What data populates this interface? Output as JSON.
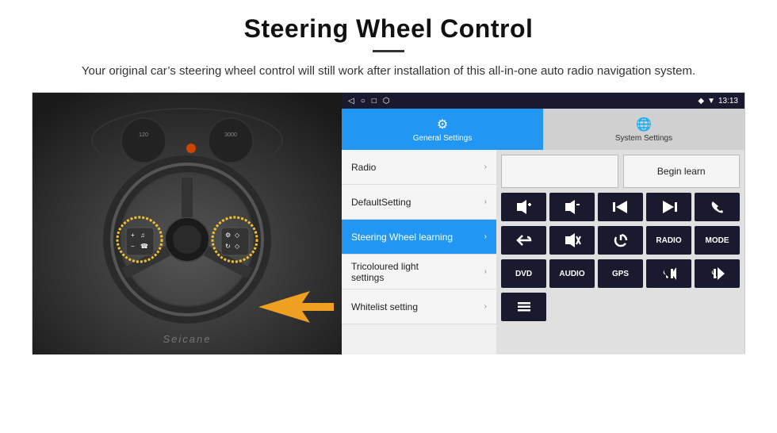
{
  "header": {
    "title": "Steering Wheel Control",
    "divider": true,
    "subtitle": "Your original car’s steering wheel control will still work after installation of this all-in-one auto radio navigation system."
  },
  "status_bar": {
    "left_icons": [
      "◁",
      "○",
      "□",
      "⬡"
    ],
    "time": "13:13",
    "signal_icons": [
      "◆",
      "▼"
    ]
  },
  "tabs": [
    {
      "label": "General Settings",
      "active": true,
      "icon": "⚙"
    },
    {
      "label": "System Settings",
      "active": false,
      "icon": "🌐"
    }
  ],
  "menu_items": [
    {
      "label": "Radio",
      "active": false
    },
    {
      "label": "DefaultSetting",
      "active": false
    },
    {
      "label": "Steering Wheel learning",
      "active": true
    },
    {
      "label": "Tricoloured light settings",
      "active": false
    },
    {
      "label": "Whitelist setting",
      "active": false
    }
  ],
  "right_panel": {
    "radio_label": "",
    "begin_learn": "Begin learn",
    "buttons_row1": [
      {
        "icon": "◀+",
        "label": "vol+"
      },
      {
        "icon": "◀−",
        "label": "vol-"
      },
      {
        "icon": "⏮",
        "label": "prev"
      },
      {
        "icon": "⏭",
        "label": "next"
      },
      {
        "icon": "✆",
        "label": "call"
      }
    ],
    "buttons_row2": [
      {
        "icon": "↩",
        "label": "back"
      },
      {
        "icon": "◀✕",
        "label": "mute"
      },
      {
        "icon": "⏻",
        "label": "power"
      },
      {
        "icon": "RADIO",
        "label": "radio"
      },
      {
        "icon": "MODE",
        "label": "mode"
      }
    ],
    "buttons_row3": [
      {
        "icon": "DVD",
        "label": "dvd"
      },
      {
        "icon": "AUDIO",
        "label": "audio"
      },
      {
        "icon": "GPS",
        "label": "gps"
      },
      {
        "icon": "📞⏮",
        "label": "call-prev"
      },
      {
        "icon": "📞⏭",
        "label": "call-next"
      }
    ],
    "buttons_row4": [
      {
        "icon": "≡",
        "label": "menu"
      }
    ]
  },
  "watermark": "Seicane"
}
